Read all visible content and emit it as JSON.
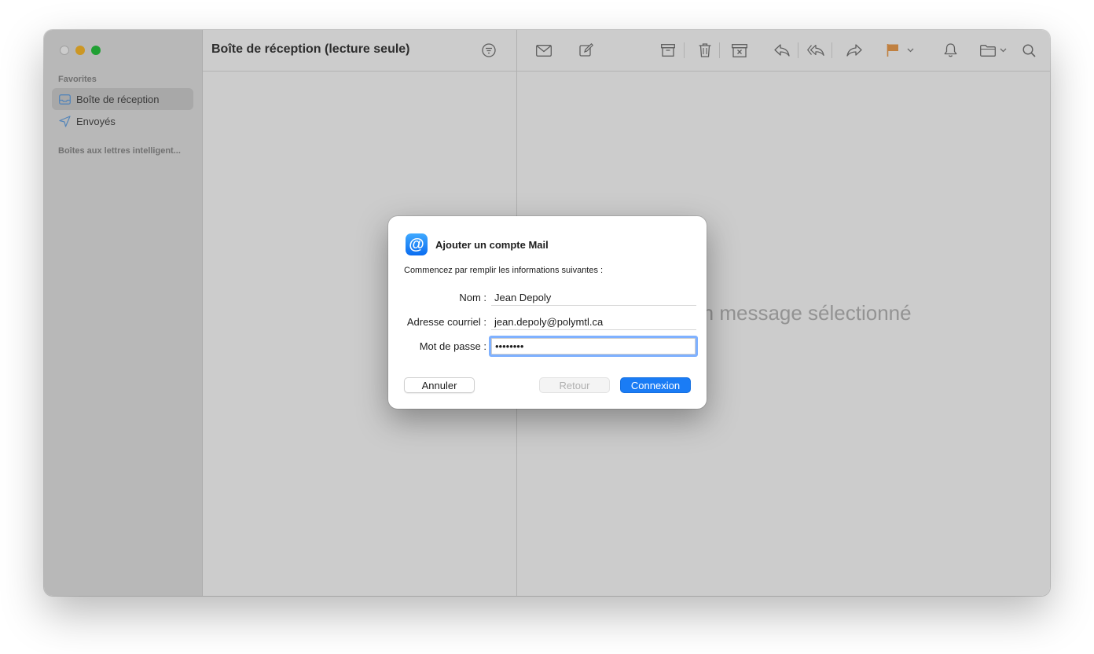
{
  "sidebar": {
    "favorites_label": "Favorites",
    "items": [
      {
        "label": "Boîte de réception",
        "icon": "inbox-icon",
        "selected": true
      },
      {
        "label": "Envoyés",
        "icon": "paper-plane-icon",
        "selected": false
      }
    ],
    "smart_mailboxes_label": "Boîtes aux lettres intelligent..."
  },
  "list": {
    "title": "Boîte de réception (lecture seule)"
  },
  "reader": {
    "empty_text": "Aucun message sélectionné"
  },
  "toolbar": {
    "icons": [
      "envelope-icon",
      "compose-icon",
      "archive-icon",
      "trash-icon",
      "junk-icon",
      "reply-icon",
      "reply-all-icon",
      "forward-icon",
      "flag-icon",
      "chevron-down-icon",
      "bell-icon",
      "folder-icon",
      "chevron-down-icon",
      "search-icon"
    ],
    "flag_color": "#f0a050"
  },
  "dialog": {
    "title": "Ajouter un compte Mail",
    "subtitle": "Commencez par remplir les informations suivantes :",
    "name_label": "Nom :",
    "name_value": "Jean Depoly",
    "email_label": "Adresse courriel :",
    "email_value": "jean.depoly@polymtl.ca",
    "password_label": "Mot de passe :",
    "password_value": "••••••••",
    "cancel_label": "Annuler",
    "back_label": "Retour",
    "connect_label": "Connexion",
    "accent_color": "#1a7cf5"
  }
}
